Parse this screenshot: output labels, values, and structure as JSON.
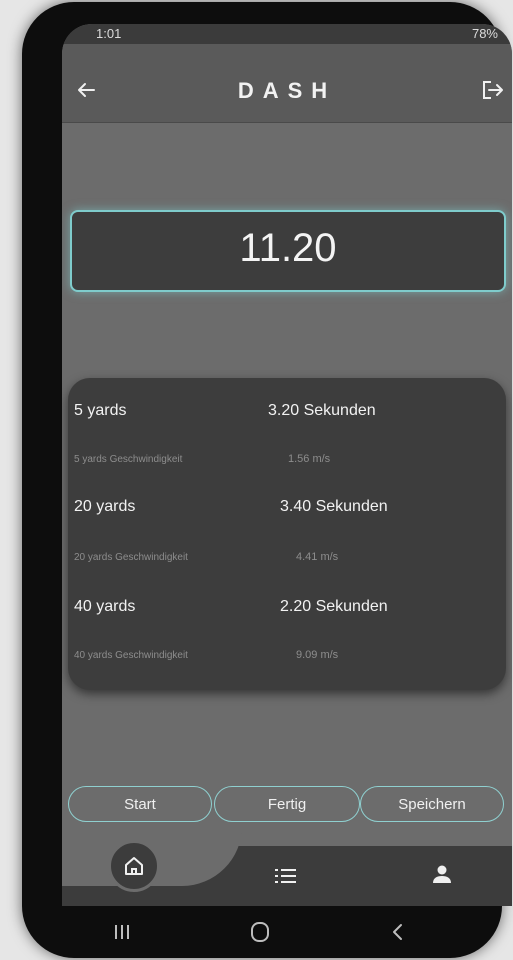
{
  "status_bar": {
    "left_text": "1:01",
    "right_text": "78%"
  },
  "app_bar": {
    "title": "DASH"
  },
  "timer": {
    "value": "11.20"
  },
  "results": [
    {
      "label": "5 yards",
      "value": "3.20 Sekunden",
      "sub_label": "5 yards Geschwindigkeit",
      "sub_value": "1.56 m/s"
    },
    {
      "label": "20 yards",
      "value": "3.40 Sekunden",
      "sub_label": "20 yards Geschwindigkeit",
      "sub_value": "4.41 m/s"
    },
    {
      "label": "40 yards",
      "value": "2.20 Sekunden",
      "sub_label": "40 yards Geschwindigkeit",
      "sub_value": "9.09 m/s"
    }
  ],
  "actions": {
    "start": "Start",
    "finish": "Fertig",
    "save": "Speichern"
  },
  "icons": [
    "arrow-left-icon",
    "logout-icon",
    "home-icon",
    "list-icon",
    "person-icon",
    "recents-icon",
    "home-circle-icon",
    "chevron-left-icon"
  ],
  "colors": {
    "accent": "#7fcccc",
    "background": "#6c6c6c",
    "panel": "#3d3d3d"
  }
}
